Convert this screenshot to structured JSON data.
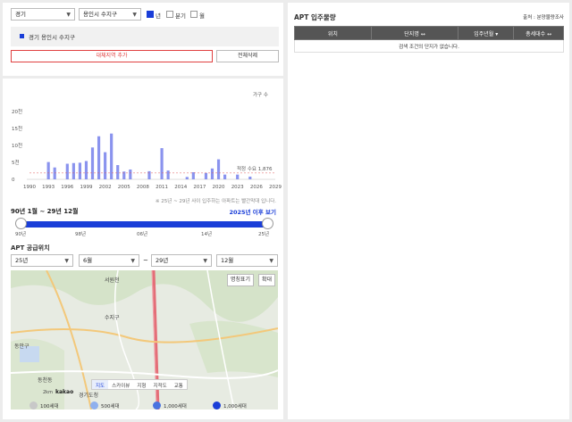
{
  "filters": {
    "region": "경기",
    "district": "용인시 수지구",
    "period_options": [
      {
        "label": "년",
        "checked": true
      },
      {
        "label": "분기",
        "checked": false
      },
      {
        "label": "월",
        "checked": false
      }
    ]
  },
  "selected_region": "경기 용인시 수지구",
  "buttons": {
    "add_compare": "대체지역 추가",
    "clear_all": "전체삭제"
  },
  "chart_data": {
    "type": "bar",
    "ylabel": "가구 수",
    "yticks": [
      "20천",
      "15천",
      "10천",
      "5천",
      "0"
    ],
    "ylim": [
      0,
      20000
    ],
    "xticks": [
      "1990",
      "1993",
      "1996",
      "1999",
      "2002",
      "2005",
      "2008",
      "2011",
      "2014",
      "2017",
      "2020",
      "2023",
      "2026",
      "2029"
    ],
    "x": [
      1990,
      1991,
      1992,
      1993,
      1994,
      1995,
      1996,
      1997,
      1998,
      1999,
      2000,
      2001,
      2002,
      2003,
      2004,
      2005,
      2006,
      2007,
      2008,
      2009,
      2010,
      2011,
      2012,
      2013,
      2014,
      2015,
      2016,
      2017,
      2018,
      2019,
      2020,
      2021,
      2022,
      2023,
      2024,
      2025,
      2026,
      2027,
      2028,
      2029
    ],
    "values": [
      0,
      0,
      0,
      5100,
      3500,
      0,
      4600,
      4800,
      4900,
      5400,
      9400,
      12700,
      8000,
      13500,
      4200,
      2300,
      2900,
      0,
      0,
      2400,
      0,
      9200,
      2600,
      0,
      0,
      700,
      2100,
      0,
      1900,
      3200,
      5900,
      1400,
      0,
      1400,
      0,
      800,
      0,
      0,
      0,
      0
    ],
    "reference_line": {
      "label": "적정 수요",
      "value": 1876,
      "value_label": "1,876"
    },
    "bar_color": "#8a93ee",
    "line_color": "#e05a5a"
  },
  "chart_note": "※ 25년 ~ 29년 사이 입주하는 아파트는 빨간막대 입니다.",
  "range": {
    "label": "90년 1월 ~ 29년 12월",
    "after_link": "2025년 이후 보기",
    "ticks": [
      "90년",
      "98년",
      "06년",
      "14년",
      "25년"
    ]
  },
  "supply": {
    "title": "APT 공급위치",
    "from_year": "25년",
    "from_month": "6월",
    "tilde": "~",
    "to_year": "29년",
    "to_month": "12월"
  },
  "map": {
    "name_toggle": "명칭표기",
    "expand": "확대",
    "labels": [
      "서원천",
      "수지구",
      "경기도청",
      "동천동",
      "동안구",
      "kakao"
    ],
    "scale": "2km",
    "tabs": [
      {
        "label": "지도",
        "active": true
      },
      {
        "label": "스카이뷰",
        "active": false
      },
      {
        "label": "지형",
        "active": false
      },
      {
        "label": "지적도",
        "active": false
      },
      {
        "label": "교통",
        "active": false
      }
    ]
  },
  "legend": [
    {
      "label": "100세대",
      "color": "#c8c8c8"
    },
    {
      "label": "500세대",
      "color": "#8fb0ee"
    },
    {
      "label": "1,000세대",
      "color": "#4a73e0"
    },
    {
      "label": "1,000세대",
      "color": "#1a3ed8"
    }
  ],
  "right_panel": {
    "title": "APT 입주물량",
    "source": "출처 : 분양물량조사",
    "columns": [
      "위치",
      "단지명 ↔",
      "입주년월 ▾",
      "총세대수 ↔"
    ],
    "empty_message": "검색 조건의 단지가 없습니다."
  },
  "colors": {
    "accent": "#1a3ed8",
    "danger": "#e04040"
  }
}
